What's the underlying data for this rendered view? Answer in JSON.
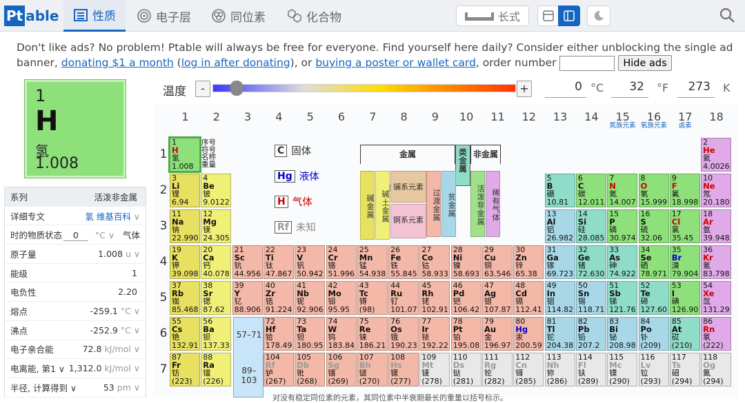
{
  "app": {
    "logo_pt": "Pt",
    "logo_able": "able"
  },
  "nav": {
    "tabs": [
      {
        "label": "性质",
        "icon": "list-icon"
      },
      {
        "label": "电子层",
        "icon": "atom-orbit-icon"
      },
      {
        "label": "同位素",
        "icon": "isotope-icon"
      },
      {
        "label": "化合物",
        "icon": "molecule-icon"
      }
    ],
    "wide_label": "长式",
    "active_tab": "性质"
  },
  "ad": {
    "line1": "Don't like ads? No problem! Ptable will always be free for everyone. Find yourself here daily? Consider either unblocking the single ad",
    "line2_pre": "banner, ",
    "link_donate": "donating $1 a month",
    "paren_open": " (",
    "link_login": "log in after donating",
    "mid": "), or ",
    "link_poster": "buying a poster or wallet card",
    "order_label": ", order number",
    "order_value": "",
    "hide_label": "Hide ads"
  },
  "selected": {
    "number": "1",
    "symbol": "H",
    "name": "氢",
    "mass": "1.008"
  },
  "properties": [
    {
      "label": "系列",
      "value": "活泼非金属",
      "unit": ""
    },
    {
      "label": "详细专文",
      "value": "氢 维基百科",
      "unit": "∨"
    },
    {
      "label": "时的物质状态",
      "value": "0",
      "unit": "°C ∨",
      "extra": "气体"
    },
    {
      "label": "原子量",
      "value": "1.008",
      "unit": "u ∨"
    },
    {
      "label": "能级",
      "value": "1",
      "unit": ""
    },
    {
      "label": "电负性",
      "value": "2.20",
      "unit": ""
    },
    {
      "label": "熔点",
      "value": "-259.1",
      "unit": "°C ∨"
    },
    {
      "label": "沸点",
      "value": "-252.9",
      "unit": "°C ∨"
    },
    {
      "label": "电子亲合能",
      "value": "72.8",
      "unit": "kJ/mol ∨"
    },
    {
      "label": "电离能, 第1 ∨",
      "value": "1,312.0",
      "unit": "kJ/mol ∨"
    },
    {
      "label": "半径, 计算得到 ∨",
      "value": "53",
      "unit": "pm ∨"
    }
  ],
  "temperature": {
    "label": "温度",
    "minus": "-",
    "plus": "+",
    "celsius": "0",
    "c_unit": "°C",
    "fahrenheit": "32",
    "f_unit": "°F",
    "kelvin": "273",
    "k_unit": "K",
    "slider_fraction": 0.06
  },
  "groups": [
    "1",
    "2",
    "3",
    "4",
    "5",
    "6",
    "7",
    "8",
    "9",
    "10",
    "11",
    "12",
    "13",
    "14",
    "15",
    "16",
    "17",
    "18"
  ],
  "group_names": {
    "15": "氮族元素",
    "16": "氧族元素",
    "17": "卤素"
  },
  "periods": [
    "1",
    "2",
    "3",
    "4",
    "5",
    "6",
    "7"
  ],
  "legend": {
    "key_lines": [
      "序号",
      "符号",
      "名称",
      "重量"
    ],
    "solid": {
      "sym": "C",
      "label": "固体"
    },
    "liquid": {
      "sym": "Hg",
      "label": "液体"
    },
    "gas": {
      "sym": "H",
      "label": "气体"
    },
    "unknown": {
      "sym": "Rf",
      "label": "未知"
    }
  },
  "categories": {
    "metal": "金属",
    "nonmetal": "非金属",
    "metalloid": "类金属",
    "cols": [
      "碱金属",
      "碱土金属",
      "镧系元素",
      "锕系元素",
      "过渡金属",
      "贫金属",
      "活泼非金属",
      "稀有气体"
    ]
  },
  "fblock": {
    "lanth": "57–71",
    "act": "89–103"
  },
  "footnote": "对没有稳定同位素的元素，其同位素中半衰期最长的重量以括号标示。",
  "colors": {
    "accent": "#1565c0",
    "nonmetal": "#8ee07a",
    "noble": "#e0aae8",
    "alkali": "#e8e060",
    "transition": "#f4b8a8"
  },
  "elements": [
    [
      "1",
      "H",
      "氢",
      "1.008",
      1,
      1,
      "c-nonmetal",
      "red"
    ],
    [
      "2",
      "He",
      "氦",
      "4.0026",
      18,
      1,
      "c-noble",
      "red"
    ],
    [
      "3",
      "Li",
      "锂",
      "6.94",
      1,
      2,
      "c-alkali",
      ""
    ],
    [
      "4",
      "Be",
      "铍",
      "9.0122",
      2,
      2,
      "c-alkearth",
      ""
    ],
    [
      "5",
      "B",
      "硼",
      "10.81",
      13,
      2,
      "c-metalloid",
      ""
    ],
    [
      "6",
      "C",
      "碳",
      "12.011",
      14,
      2,
      "c-nonmetal",
      ""
    ],
    [
      "7",
      "N",
      "氮",
      "14.007",
      15,
      2,
      "c-nonmetal",
      "red"
    ],
    [
      "8",
      "O",
      "氧",
      "15.999",
      16,
      2,
      "c-nonmetal",
      "red"
    ],
    [
      "9",
      "F",
      "氟",
      "18.998",
      17,
      2,
      "c-nonmetal",
      "red"
    ],
    [
      "10",
      "Ne",
      "氖",
      "20.180",
      18,
      2,
      "c-noble",
      "red"
    ],
    [
      "11",
      "Na",
      "钠",
      "22.990",
      1,
      3,
      "c-alkali",
      ""
    ],
    [
      "12",
      "Mg",
      "镁",
      "24.305",
      2,
      3,
      "c-alkearth",
      ""
    ],
    [
      "13",
      "Al",
      "铝",
      "26.982",
      13,
      3,
      "c-post",
      ""
    ],
    [
      "14",
      "Si",
      "硅",
      "28.085",
      14,
      3,
      "c-metalloid",
      ""
    ],
    [
      "15",
      "P",
      "磷",
      "30.974",
      15,
      3,
      "c-nonmetal",
      ""
    ],
    [
      "16",
      "S",
      "硫",
      "32.06",
      16,
      3,
      "c-nonmetal",
      ""
    ],
    [
      "17",
      "Cl",
      "氯",
      "35.45",
      17,
      3,
      "c-nonmetal",
      "red"
    ],
    [
      "18",
      "Ar",
      "氩",
      "39.948",
      18,
      3,
      "c-noble",
      "red"
    ],
    [
      "19",
      "K",
      "钾",
      "39.098",
      1,
      4,
      "c-alkali",
      ""
    ],
    [
      "20",
      "Ca",
      "钙",
      "40.078",
      2,
      4,
      "c-alkearth",
      ""
    ],
    [
      "21",
      "Sc",
      "钪",
      "44.956",
      3,
      4,
      "c-trans",
      ""
    ],
    [
      "22",
      "Ti",
      "钛",
      "47.867",
      4,
      4,
      "c-trans",
      ""
    ],
    [
      "23",
      "V",
      "钒",
      "50.942",
      5,
      4,
      "c-trans",
      ""
    ],
    [
      "24",
      "Cr",
      "铬",
      "51.996",
      6,
      4,
      "c-trans",
      ""
    ],
    [
      "25",
      "Mn",
      "锰",
      "54.938",
      7,
      4,
      "c-trans",
      ""
    ],
    [
      "26",
      "Fe",
      "铁",
      "55.845",
      8,
      4,
      "c-trans",
      ""
    ],
    [
      "27",
      "Co",
      "钴",
      "58.933",
      9,
      4,
      "c-trans",
      ""
    ],
    [
      "28",
      "Ni",
      "镍",
      "58.693",
      10,
      4,
      "c-trans",
      ""
    ],
    [
      "29",
      "Cu",
      "铜",
      "63.546",
      11,
      4,
      "c-trans",
      ""
    ],
    [
      "30",
      "Zn",
      "锌",
      "65.38",
      12,
      4,
      "c-trans",
      ""
    ],
    [
      "31",
      "Ga",
      "镓",
      "69.723",
      13,
      4,
      "c-post",
      ""
    ],
    [
      "32",
      "Ge",
      "锗",
      "72.630",
      14,
      4,
      "c-metalloid",
      ""
    ],
    [
      "33",
      "As",
      "砷",
      "74.922",
      15,
      4,
      "c-metalloid",
      ""
    ],
    [
      "34",
      "Se",
      "硒",
      "78.971",
      16,
      4,
      "c-nonmetal",
      ""
    ],
    [
      "35",
      "Br",
      "溴",
      "79.904",
      17,
      4,
      "c-nonmetal",
      "blue"
    ],
    [
      "36",
      "Kr",
      "氪",
      "83.798",
      18,
      4,
      "c-noble",
      "red"
    ],
    [
      "37",
      "Rb",
      "铷",
      "85.468",
      1,
      5,
      "c-alkali",
      ""
    ],
    [
      "38",
      "Sr",
      "锶",
      "87.62",
      2,
      5,
      "c-alkearth",
      ""
    ],
    [
      "39",
      "Y",
      "钇",
      "88.906",
      3,
      5,
      "c-trans",
      ""
    ],
    [
      "40",
      "Zr",
      "锆",
      "91.224",
      4,
      5,
      "c-trans",
      ""
    ],
    [
      "41",
      "Nb",
      "铌",
      "92.906",
      5,
      5,
      "c-trans",
      ""
    ],
    [
      "42",
      "Mo",
      "钼",
      "95.95",
      6,
      5,
      "c-trans",
      ""
    ],
    [
      "43",
      "Tc",
      "锝",
      "(98)",
      7,
      5,
      "c-trans",
      ""
    ],
    [
      "44",
      "Ru",
      "钌",
      "101.07",
      8,
      5,
      "c-trans",
      ""
    ],
    [
      "45",
      "Rh",
      "铑",
      "102.91",
      9,
      5,
      "c-trans",
      ""
    ],
    [
      "46",
      "Pd",
      "钯",
      "106.42",
      10,
      5,
      "c-trans",
      ""
    ],
    [
      "47",
      "Ag",
      "银",
      "107.87",
      11,
      5,
      "c-trans",
      ""
    ],
    [
      "48",
      "Cd",
      "镉",
      "112.41",
      12,
      5,
      "c-trans",
      ""
    ],
    [
      "49",
      "In",
      "铟",
      "114.82",
      13,
      5,
      "c-post",
      ""
    ],
    [
      "50",
      "Sn",
      "锡",
      "118.71",
      14,
      5,
      "c-post",
      ""
    ],
    [
      "51",
      "Sb",
      "锑",
      "121.76",
      15,
      5,
      "c-metalloid",
      ""
    ],
    [
      "52",
      "Te",
      "碲",
      "127.60",
      16,
      5,
      "c-metalloid",
      ""
    ],
    [
      "53",
      "I",
      "碘",
      "126.90",
      17,
      5,
      "c-nonmetal",
      ""
    ],
    [
      "54",
      "Xe",
      "氙",
      "131.29",
      18,
      5,
      "c-noble",
      "red"
    ],
    [
      "55",
      "Cs",
      "铯",
      "132.91",
      1,
      6,
      "c-alkali",
      ""
    ],
    [
      "56",
      "Ba",
      "钡",
      "137.33",
      2,
      6,
      "c-alkearth",
      ""
    ],
    [
      "72",
      "Hf",
      "铪",
      "178.49",
      4,
      6,
      "c-trans",
      ""
    ],
    [
      "73",
      "Ta",
      "钽",
      "180.95",
      5,
      6,
      "c-trans",
      ""
    ],
    [
      "74",
      "W",
      "钨",
      "183.84",
      6,
      6,
      "c-trans",
      ""
    ],
    [
      "75",
      "Re",
      "铼",
      "186.21",
      7,
      6,
      "c-trans",
      ""
    ],
    [
      "76",
      "Os",
      "锇",
      "190.23",
      8,
      6,
      "c-trans",
      ""
    ],
    [
      "77",
      "Ir",
      "铱",
      "192.22",
      9,
      6,
      "c-trans",
      ""
    ],
    [
      "78",
      "Pt",
      "铂",
      "195.08",
      10,
      6,
      "c-trans",
      ""
    ],
    [
      "79",
      "Au",
      "金",
      "196.97",
      11,
      6,
      "c-trans",
      ""
    ],
    [
      "80",
      "Hg",
      "汞",
      "200.59",
      12,
      6,
      "c-trans",
      "blue"
    ],
    [
      "81",
      "Tl",
      "铊",
      "204.38",
      13,
      6,
      "c-post",
      ""
    ],
    [
      "82",
      "Pb",
      "铅",
      "207.2",
      14,
      6,
      "c-post",
      ""
    ],
    [
      "83",
      "Bi",
      "铋",
      "208.98",
      15,
      6,
      "c-post",
      ""
    ],
    [
      "84",
      "Po",
      "钋",
      "(209)",
      16,
      6,
      "c-post",
      ""
    ],
    [
      "85",
      "At",
      "砹",
      "(210)",
      17,
      6,
      "c-metalloid",
      ""
    ],
    [
      "86",
      "Rn",
      "氡",
      "(222)",
      18,
      6,
      "c-noble",
      "red"
    ],
    [
      "87",
      "Fr",
      "钫",
      "(223)",
      1,
      7,
      "c-alkali",
      ""
    ],
    [
      "88",
      "Ra",
      "镭",
      "(226)",
      2,
      7,
      "c-alkearth",
      ""
    ],
    [
      "104",
      "Rf",
      "𬬻",
      "(267)",
      4,
      7,
      "c-trans",
      "gray"
    ],
    [
      "105",
      "Db",
      "𬭊",
      "(268)",
      5,
      7,
      "c-trans",
      "gray"
    ],
    [
      "106",
      "Sg",
      "𬭳",
      "(269)",
      6,
      7,
      "c-trans",
      "gray"
    ],
    [
      "107",
      "Bh",
      "𬭛",
      "(270)",
      7,
      7,
      "c-trans",
      "gray"
    ],
    [
      "108",
      "Hs",
      "𬭶",
      "(277)",
      8,
      7,
      "c-trans",
      "gray"
    ],
    [
      "109",
      "Mt",
      "鿏",
      "(278)",
      9,
      7,
      "c-unknown",
      "gray"
    ],
    [
      "110",
      "Ds",
      "𫟼",
      "(281)",
      10,
      7,
      "c-unknown",
      "gray"
    ],
    [
      "111",
      "Rg",
      "𬬭",
      "(282)",
      11,
      7,
      "c-unknown",
      "gray"
    ],
    [
      "112",
      "Cn",
      "鿔",
      "(285)",
      12,
      7,
      "c-unknown",
      "gray"
    ],
    [
      "113",
      "Nh",
      "鿭",
      "(286)",
      13,
      7,
      "c-unknown",
      "gray"
    ],
    [
      "114",
      "Fl",
      "𫓧",
      "(289)",
      14,
      7,
      "c-unknown",
      "gray"
    ],
    [
      "115",
      "Mc",
      "镆",
      "(290)",
      15,
      7,
      "c-unknown",
      "gray"
    ],
    [
      "116",
      "Lv",
      "𫟷",
      "(293)",
      16,
      7,
      "c-unknown",
      "gray"
    ],
    [
      "117",
      "Ts",
      "鿬",
      "(294)",
      17,
      7,
      "c-unknown",
      "gray"
    ],
    [
      "118",
      "Og",
      "鿫",
      "(294)",
      18,
      7,
      "c-unknown",
      "gray"
    ]
  ]
}
